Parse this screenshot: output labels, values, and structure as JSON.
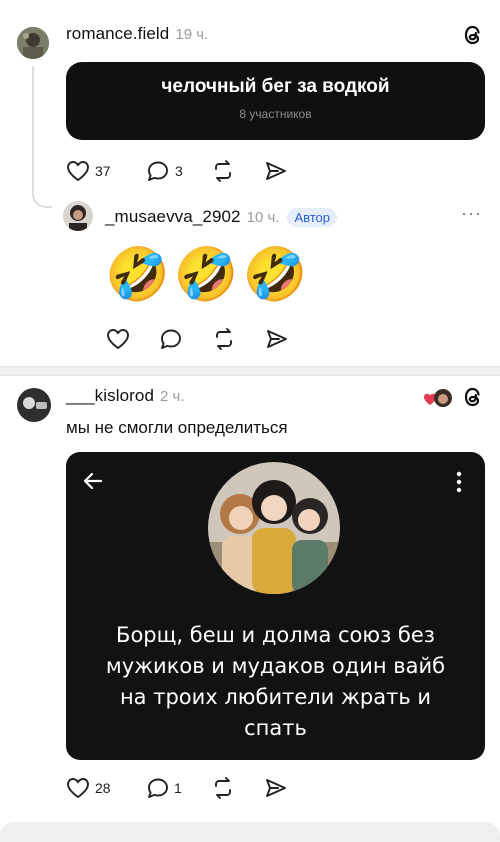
{
  "post1": {
    "username": "romance.field",
    "time": "19 ч.",
    "poll": {
      "title": "челочный бег за водкой",
      "subtitle": "8 участников"
    },
    "likes": "37",
    "comments": "3"
  },
  "reply1": {
    "username": "_musaevva_2902",
    "time": "10 ч.",
    "badge": "Автор",
    "content": "🤣🤣🤣",
    "more": "···"
  },
  "post2": {
    "username": "___kislorod",
    "time": "2 ч.",
    "text": "мы не смогли определиться",
    "card_text": "Борщ, беш и долма союз без мужиков и мудаков один вайб на троих любители жрать и спать",
    "likes": "28",
    "comments": "1"
  },
  "colors": {
    "accent_blue": "#2a5fd0",
    "card_bg": "#121212",
    "poll_bg": "#101010"
  },
  "icons": [
    "threads-logo-icon",
    "heart-icon",
    "comment-icon",
    "repost-icon",
    "share-icon",
    "back-arrow-icon",
    "more-vertical-icon"
  ]
}
